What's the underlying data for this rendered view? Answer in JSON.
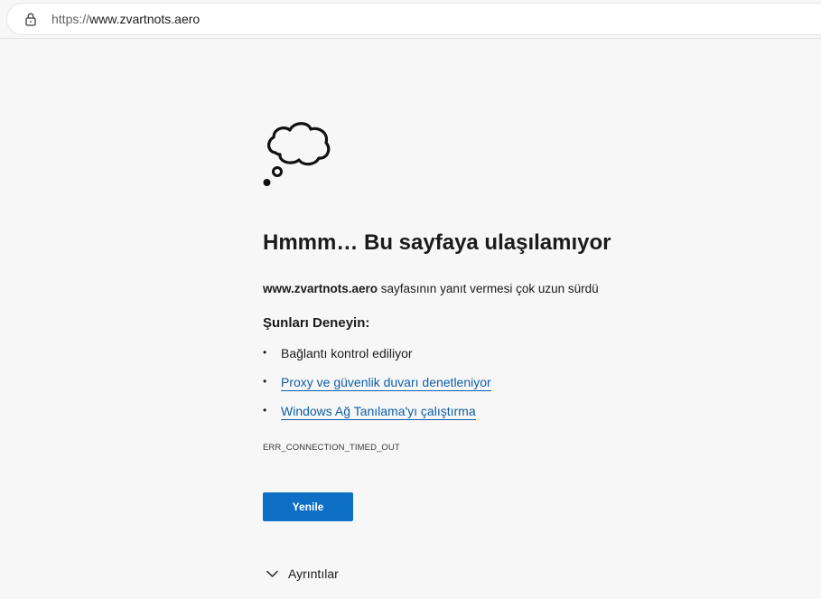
{
  "browser": {
    "url_scheme": "https://",
    "url_host": "www.zvartnots.aero",
    "lock_icon": "lock-icon"
  },
  "error_page": {
    "icon": "thought-cloud-icon",
    "title": "Hmmm… Bu sayfaya ulaşılamıyor",
    "host": "www.zvartnots.aero",
    "description_rest": " sayfasının yanıt vermesi çok uzun sürdü",
    "suggestions_heading": "Şunları Deneyin:",
    "bullet": "•",
    "suggestions": [
      {
        "label": "Bağlantı kontrol ediliyor",
        "is_link": false
      },
      {
        "label": "Proxy ve güvenlik duvarı denetleniyor",
        "is_link": true
      },
      {
        "label": "Windows Ağ Tanılama'yı çalıştırma",
        "is_link": true
      }
    ],
    "error_code": "ERR_CONNECTION_TIMED_OUT",
    "refresh_label": "Yenile",
    "details_label": "Ayrıntılar",
    "details_icon": "chevron-down-icon",
    "colors": {
      "link": "#0e5ea8",
      "button": "#0e6fc7",
      "background": "#f7f7f7"
    }
  }
}
